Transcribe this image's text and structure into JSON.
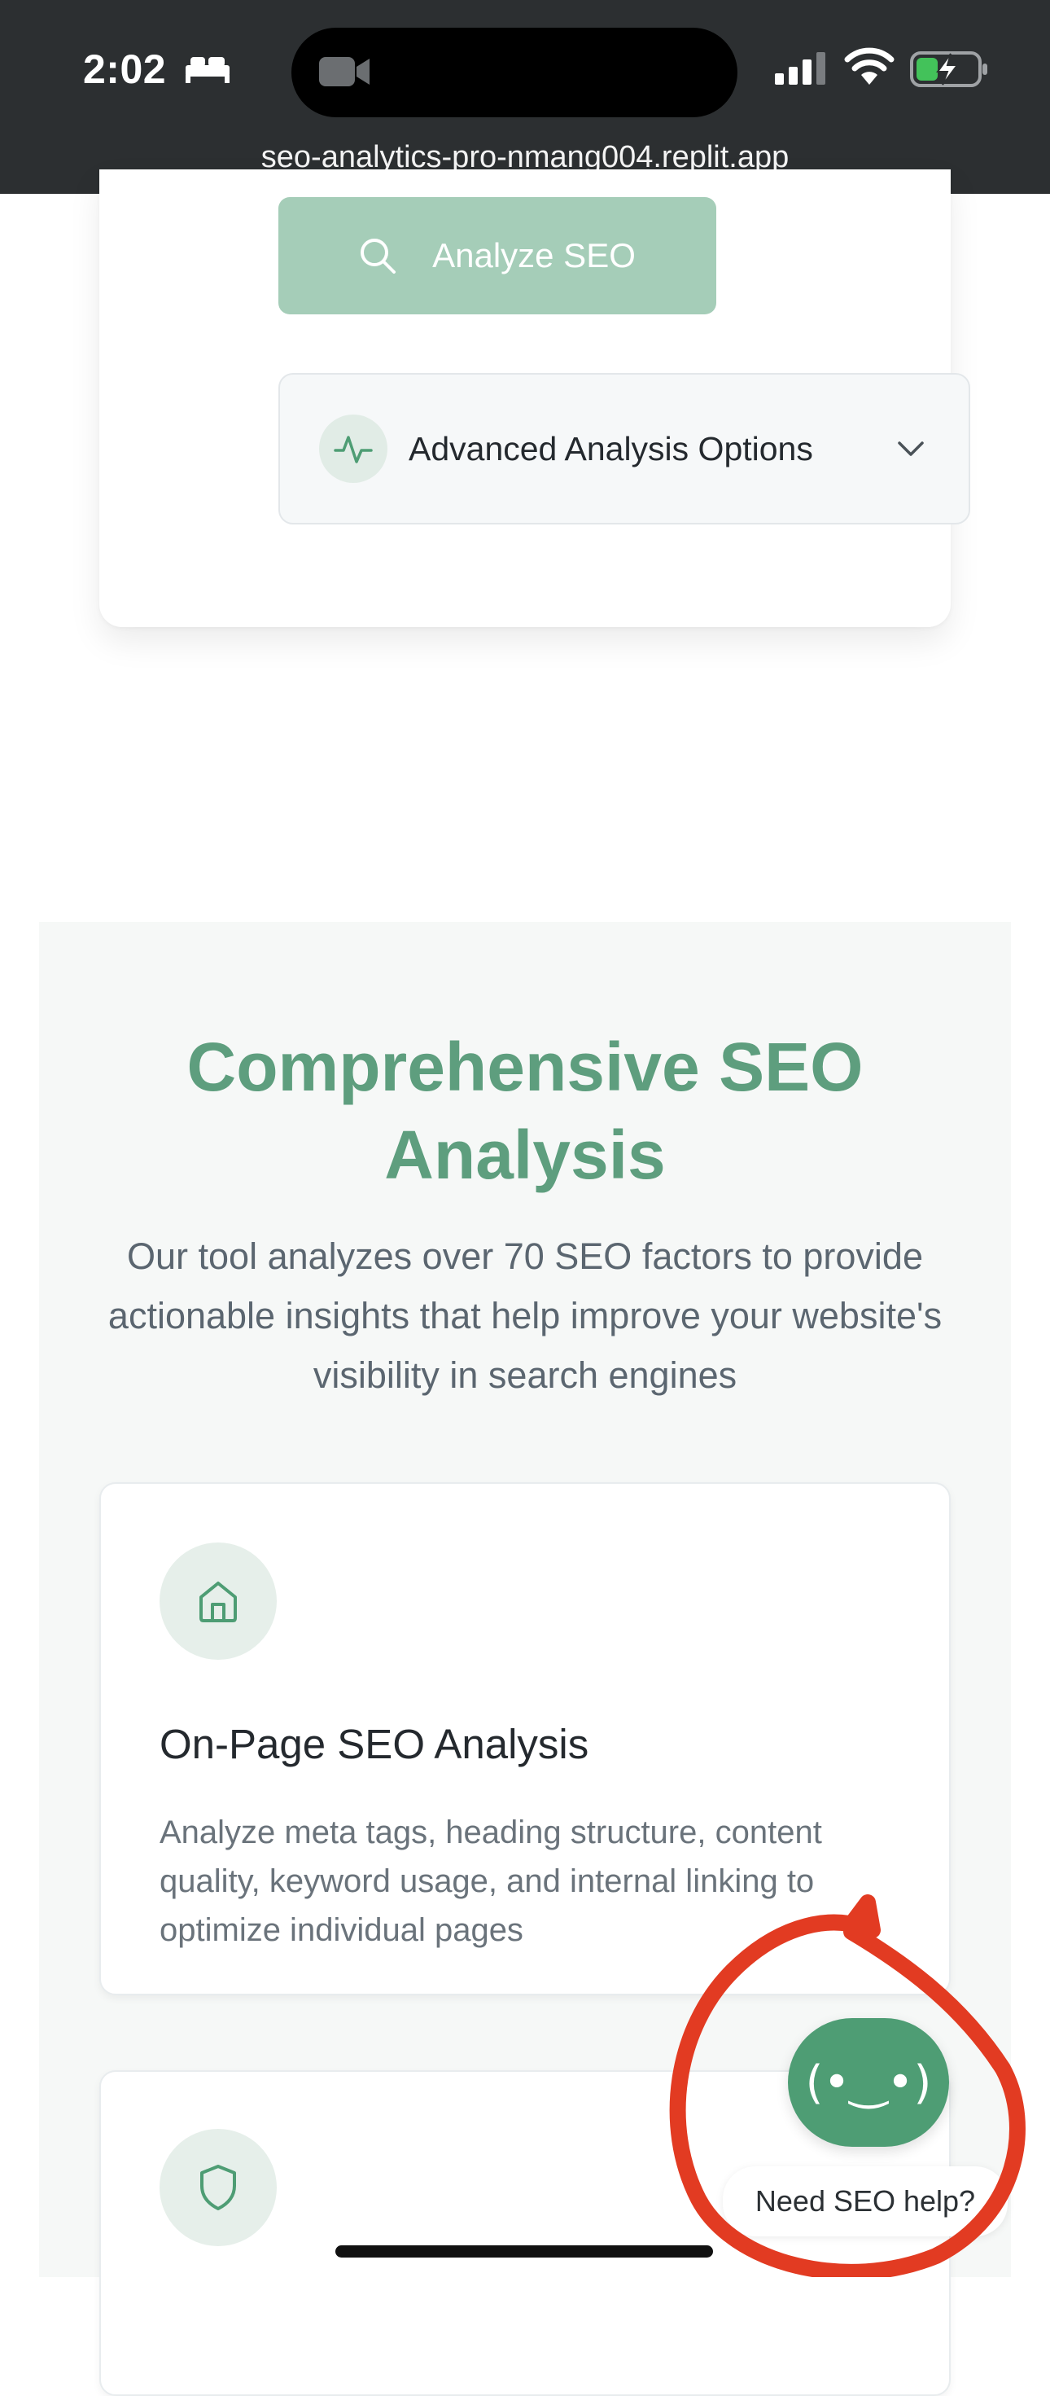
{
  "status_bar": {
    "time": "2:02",
    "url": "seo-analytics-pro-nmang004.replit.app",
    "icons": [
      "bed-icon",
      "video-camera-icon",
      "cellular-signal-icon",
      "wifi-icon",
      "battery-charging-icon"
    ]
  },
  "analyzer": {
    "analyze_label": "Analyze SEO",
    "advanced_label": "Advanced Analysis Options"
  },
  "features_section": {
    "title": "Comprehensive SEO Analysis",
    "subtitle": "Our tool analyzes over 70 SEO factors to provide actionable insights that help improve your website's visibility in search engines",
    "cards": [
      {
        "icon": "home-icon",
        "title": "On-Page SEO Analysis",
        "description": "Analyze meta tags, heading structure, content quality, keyword usage, and internal linking to optimize individual pages"
      },
      {
        "icon": "shield-icon"
      }
    ]
  },
  "chat": {
    "face": "(•‿•)",
    "tooltip": "Need SEO help?"
  },
  "colors": {
    "brand_green": "#4e9d74",
    "disabled_green": "#a5cdb8",
    "title_green": "#5e9e7e",
    "annotation_red": "#e23b22"
  }
}
